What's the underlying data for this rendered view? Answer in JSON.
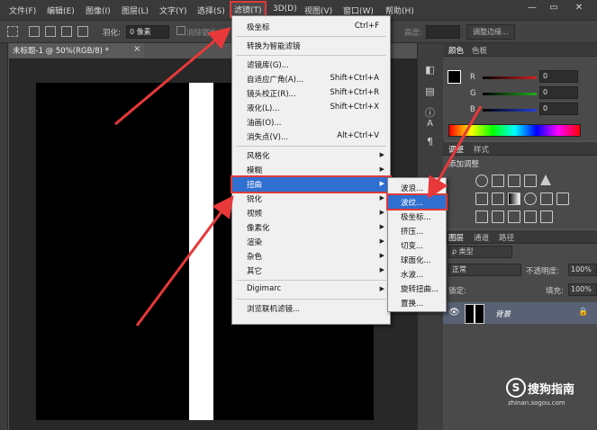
{
  "menubar": {
    "items": [
      "文件(F)",
      "编辑(E)",
      "图像(I)",
      "图层(L)",
      "文字(Y)",
      "选择(S)",
      "滤镜(T)",
      "3D(D)",
      "视图(V)",
      "窗口(W)",
      "帮助(H)"
    ],
    "active_index": 6,
    "window_controls": [
      "—",
      "▭",
      "✕"
    ]
  },
  "options": {
    "feather_label": "羽化:",
    "feather_value": "0 像素",
    "antialias_label": "消除锯齿",
    "height_label": "高度:",
    "refine_edge": "调整边缘..."
  },
  "document": {
    "tab_title": "未标题-1 @ 50%(RGB/8) *",
    "close": "×"
  },
  "filter_menu": {
    "items": [
      {
        "label": "极坐标",
        "shortcut": "Ctrl+F"
      },
      {
        "sep": true
      },
      {
        "label": "转换为智能滤镜"
      },
      {
        "sep": true
      },
      {
        "label": "滤镜库(G)..."
      },
      {
        "label": "自适应广角(A)...",
        "shortcut": "Shift+Ctrl+A"
      },
      {
        "label": "镜头校正(R)...",
        "shortcut": "Shift+Ctrl+R"
      },
      {
        "label": "液化(L)...",
        "shortcut": "Shift+Ctrl+X"
      },
      {
        "label": "油画(O)..."
      },
      {
        "label": "消失点(V)...",
        "shortcut": "Alt+Ctrl+V"
      },
      {
        "sep": true
      },
      {
        "label": "风格化",
        "submenu": true
      },
      {
        "label": "模糊",
        "submenu": true
      },
      {
        "label": "扭曲",
        "submenu": true,
        "selected": true
      },
      {
        "label": "锐化",
        "submenu": true
      },
      {
        "label": "视频",
        "submenu": true
      },
      {
        "label": "像素化",
        "submenu": true
      },
      {
        "label": "渲染",
        "submenu": true
      },
      {
        "label": "杂色",
        "submenu": true
      },
      {
        "label": "其它",
        "submenu": true
      },
      {
        "sep": true
      },
      {
        "label": "Digimarc",
        "submenu": true
      },
      {
        "sep": true
      },
      {
        "label": "浏览联机滤镜..."
      }
    ]
  },
  "distort_submenu": {
    "items": [
      {
        "label": "波浪..."
      },
      {
        "label": "波纹...",
        "selected": true
      },
      {
        "label": "极坐标..."
      },
      {
        "label": "挤压..."
      },
      {
        "label": "切变..."
      },
      {
        "label": "球面化..."
      },
      {
        "label": "水波..."
      },
      {
        "label": "旋转扭曲..."
      },
      {
        "label": "置换..."
      }
    ]
  },
  "color_panel": {
    "tabs": [
      "颜色",
      "色板"
    ],
    "channels": [
      {
        "label": "R",
        "value": "0",
        "color": "#d42020"
      },
      {
        "label": "G",
        "value": "0",
        "color": "#20b020"
      },
      {
        "label": "B",
        "value": "0",
        "color": "#2040e0"
      }
    ]
  },
  "adjust_panel": {
    "tabs": [
      "调整",
      "样式"
    ],
    "title": "添加调整"
  },
  "layers_panel": {
    "tabs": [
      "图层",
      "通道",
      "路径"
    ],
    "kind_label": "ρ 类型",
    "blend_mode": "正常",
    "opacity_label": "不透明度:",
    "opacity_value": "100%",
    "lock_label": "锁定:",
    "fill_label": "填充:",
    "fill_value": "100%",
    "layer_name": "背景"
  },
  "watermark": {
    "logo": "S",
    "text": "搜狗指南",
    "url": "zhinan.sogou.com"
  },
  "icons": [
    "eye-icon",
    "lock-icon",
    "gear-icon",
    "brightness-icon",
    "levels-icon",
    "curves-icon",
    "exposure-icon"
  ]
}
